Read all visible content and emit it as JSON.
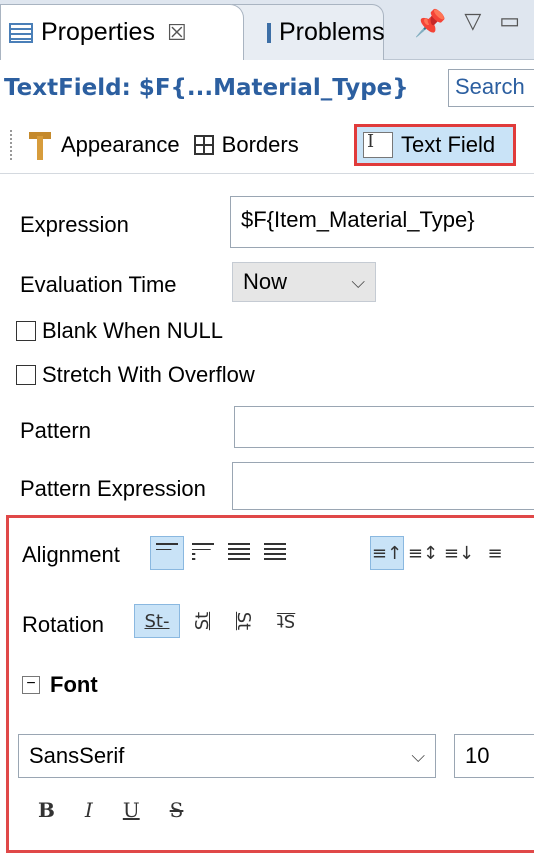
{
  "tabs": {
    "properties_label": "Properties",
    "properties_close": "☒",
    "problems_label": "Problems"
  },
  "view_tools": {
    "pin": "📌",
    "menu": "▽",
    "minimize": "▭"
  },
  "header": {
    "title": "TextField: $F{...Material_Type}",
    "search_label": "Search"
  },
  "sections": {
    "appearance": "Appearance",
    "borders": "Borders",
    "text_field": "Text Field"
  },
  "form": {
    "expression_label": "Expression",
    "expression_value": "$F{Item_Material_Type}",
    "evaluation_time_label": "Evaluation Time",
    "evaluation_time_value": "Now",
    "blank_when_null_label": "Blank When NULL",
    "stretch_with_overflow_label": "Stretch With Overflow",
    "pattern_label": "Pattern",
    "pattern_value": "",
    "pattern_expression_label": "Pattern Expression",
    "pattern_expression_value": ""
  },
  "alignment": {
    "label": "Alignment",
    "vertical_icons": [
      "≡↑",
      "≡↕",
      "≡↓",
      "≡"
    ]
  },
  "rotation": {
    "label": "Rotation",
    "options": [
      "St-",
      "St",
      "St",
      "St"
    ]
  },
  "font": {
    "section_label": "Font",
    "collapse_symbol": "−",
    "family_value": "SansSerif",
    "size_value": "10",
    "style_buttons": [
      "B",
      "I",
      "U",
      "S"
    ]
  }
}
